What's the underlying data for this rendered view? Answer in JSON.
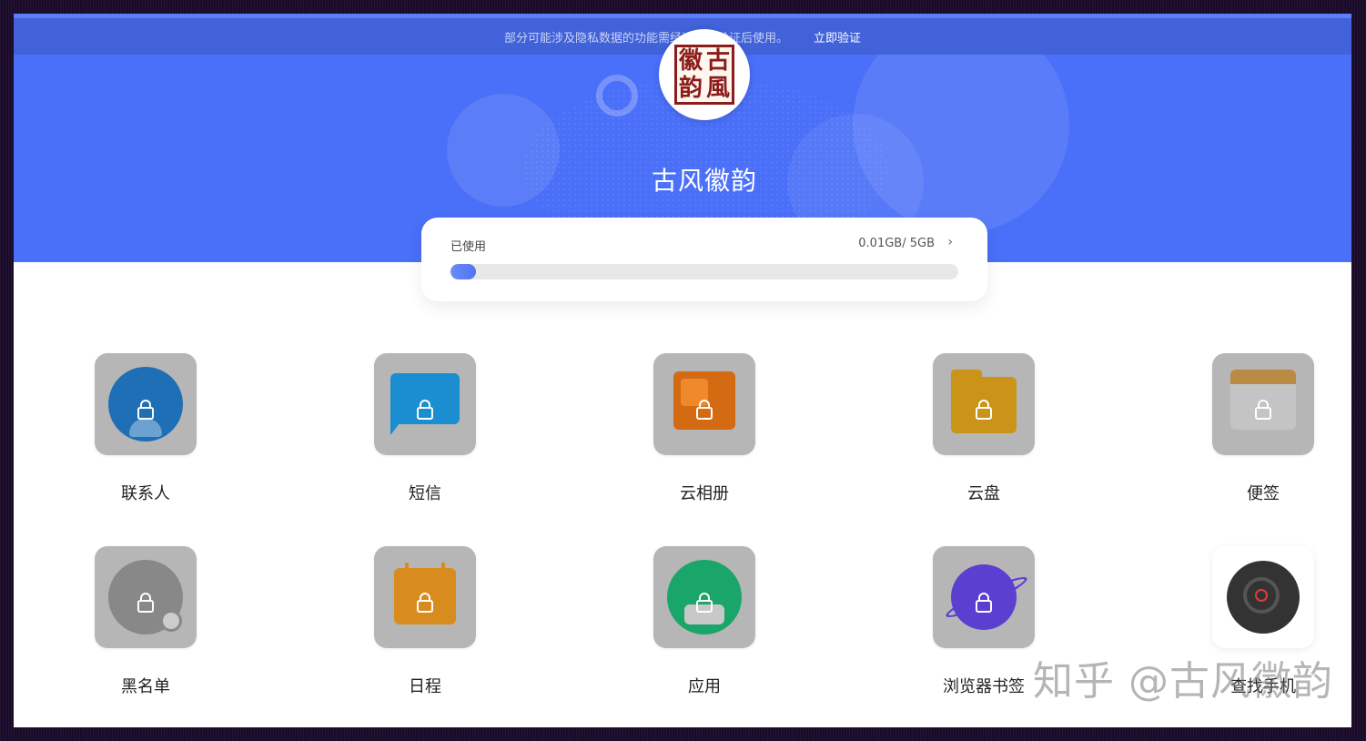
{
  "notice": {
    "text": "部分可能涉及隐私数据的功能需经过安全验证后使用。",
    "link": "立即验证"
  },
  "profile": {
    "seal_chars": [
      "古",
      "風",
      "徽",
      "韵"
    ],
    "name": "古风徽韵"
  },
  "storage": {
    "label": "已使用",
    "value": "0.01GB/ 5GB",
    "used_fraction": 0.002,
    "min_display_fraction": 0.05
  },
  "apps": [
    {
      "label": "联系人",
      "icon": "contacts-icon",
      "color": "#1f6fb6"
    },
    {
      "label": "短信",
      "icon": "message-icon",
      "color": "#1a8ed1"
    },
    {
      "label": "云相册",
      "icon": "cloud-album-icon",
      "color": "#d46a12"
    },
    {
      "label": "云盘",
      "icon": "cloud-drive-icon",
      "color": "#c99418"
    },
    {
      "label": "便签",
      "icon": "notes-icon",
      "color": "#b98a44"
    },
    {
      "label": "黑名单",
      "icon": "blacklist-icon",
      "color": "#888888"
    },
    {
      "label": "日程",
      "icon": "calendar-icon",
      "color": "#d98c1e"
    },
    {
      "label": "应用",
      "icon": "apps-icon",
      "color": "#1aa56a"
    },
    {
      "label": "浏览器书签",
      "icon": "browser-bookmark-icon",
      "color": "#5a3fd0"
    },
    {
      "label": "查找手机",
      "icon": "find-phone-icon",
      "color": "#333333"
    }
  ],
  "watermark": "知乎 @古风徽韵",
  "colors": {
    "hero": "#4a6ff8",
    "notice_bar": "#4162d8",
    "tile_locked": "#b6b6b6"
  }
}
